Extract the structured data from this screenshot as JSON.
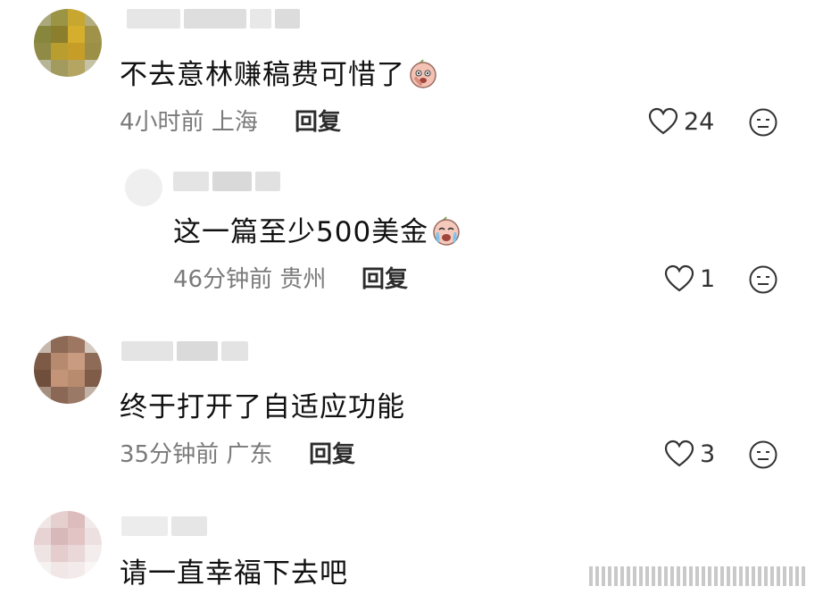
{
  "comments": [
    {
      "text": "不去意林赚稿费可惜了",
      "time": "4小时前",
      "location": "上海",
      "reply": "回复",
      "likes": "24",
      "emoji": "flushed-face-emoji"
    },
    {
      "text": "这一篇至少500美金",
      "time": "46分钟前",
      "location": "贵州",
      "reply": "回复",
      "likes": "1",
      "emoji": "crying-face-emoji"
    },
    {
      "text": "终于打开了自适应功能",
      "time": "35分钟前",
      "location": "广东",
      "reply": "回复",
      "likes": "3"
    },
    {
      "text": "请一直幸福下去吧"
    }
  ]
}
